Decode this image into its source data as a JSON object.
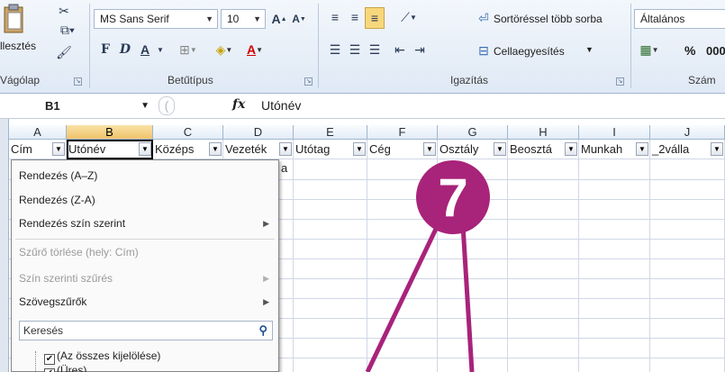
{
  "ribbon": {
    "clipboard": {
      "paste_label": "llesztés",
      "group_label": "Vágólap"
    },
    "font": {
      "font_name": "MS Sans Serif",
      "font_size": "10",
      "bold": "F",
      "italic": "D",
      "underline": "A",
      "group_label": "Betűtípus"
    },
    "alignment": {
      "wrap_text": "Sortöréssel több sorba",
      "merge_cells": "Cellaegyesítés",
      "group_label": "Igazítás"
    },
    "number": {
      "format": "Általános",
      "percent": "%",
      "thousands": "000",
      "group_label": "Szám"
    }
  },
  "formula_bar": {
    "cell_ref": "B1",
    "fx": "fx",
    "value": "Utónév"
  },
  "columns": [
    "A",
    "B",
    "C",
    "D",
    "E",
    "F",
    "G",
    "H",
    "I",
    "J"
  ],
  "header_row": [
    "Cím",
    "Utónév",
    "Középs",
    "Vezeték",
    "Utótag",
    "Cég",
    "Osztály",
    "Beosztá",
    "Munkah",
    "_2válla"
  ],
  "partial_cell_text": "a",
  "filter_menu": {
    "sort_az": "Rendezés (A–Z)",
    "sort_za": "Rendezés (Z-A)",
    "sort_color": "Rendezés szín szerint",
    "clear_filter": "Szűrő törlése (hely: Cím)",
    "filter_color": "Szín szerinti szűrés",
    "text_filters": "Szövegszűrők",
    "search_placeholder": "Keresés",
    "select_all": "(Az összes kijelölése)",
    "blank": "(Üres)"
  },
  "callout": {
    "number": "7",
    "color": "#a8237a"
  },
  "colors": {
    "selected_col": "#f0c36b",
    "ribbon_bg": "#dfe9f5",
    "grid_line": "#d0d7e5"
  }
}
